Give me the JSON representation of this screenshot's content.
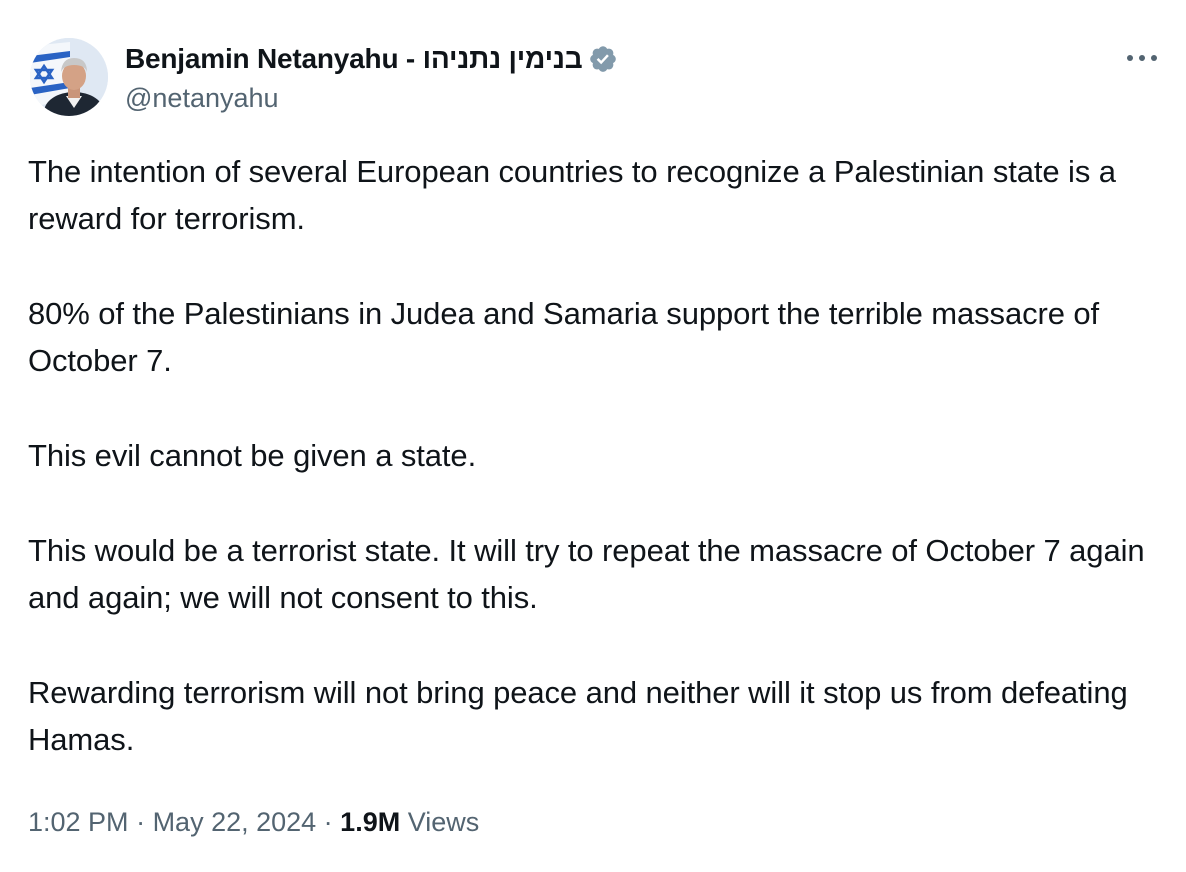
{
  "author": {
    "display_name": "Benjamin Netanyahu - בנימין נתניהו",
    "handle": "@netanyahu",
    "avatar_icon": "profile-photo",
    "verified_icon": "verified-badge-icon",
    "verified_color": "#829aab"
  },
  "more_icon": "more-options-icon",
  "tweet": {
    "paragraphs": [
      "The intention of several European countries to recognize a Palestinian state is a reward for terrorism.",
      "80% of the Palestinians in Judea and Samaria support the terrible massacre of October 7.",
      "This evil cannot be given a state.",
      "This would be a terrorist state. It will try to repeat the massacre of October 7 again and again; we will not consent to this.",
      "Rewarding terrorism will not bring peace and neither will it stop us from defeating Hamas."
    ]
  },
  "meta": {
    "time": "1:02 PM",
    "separator": " · ",
    "date": "May 22, 2024",
    "views_count": "1.9M",
    "views_label": " Views"
  },
  "colors": {
    "text": "#0f1419",
    "secondary": "#536471"
  }
}
